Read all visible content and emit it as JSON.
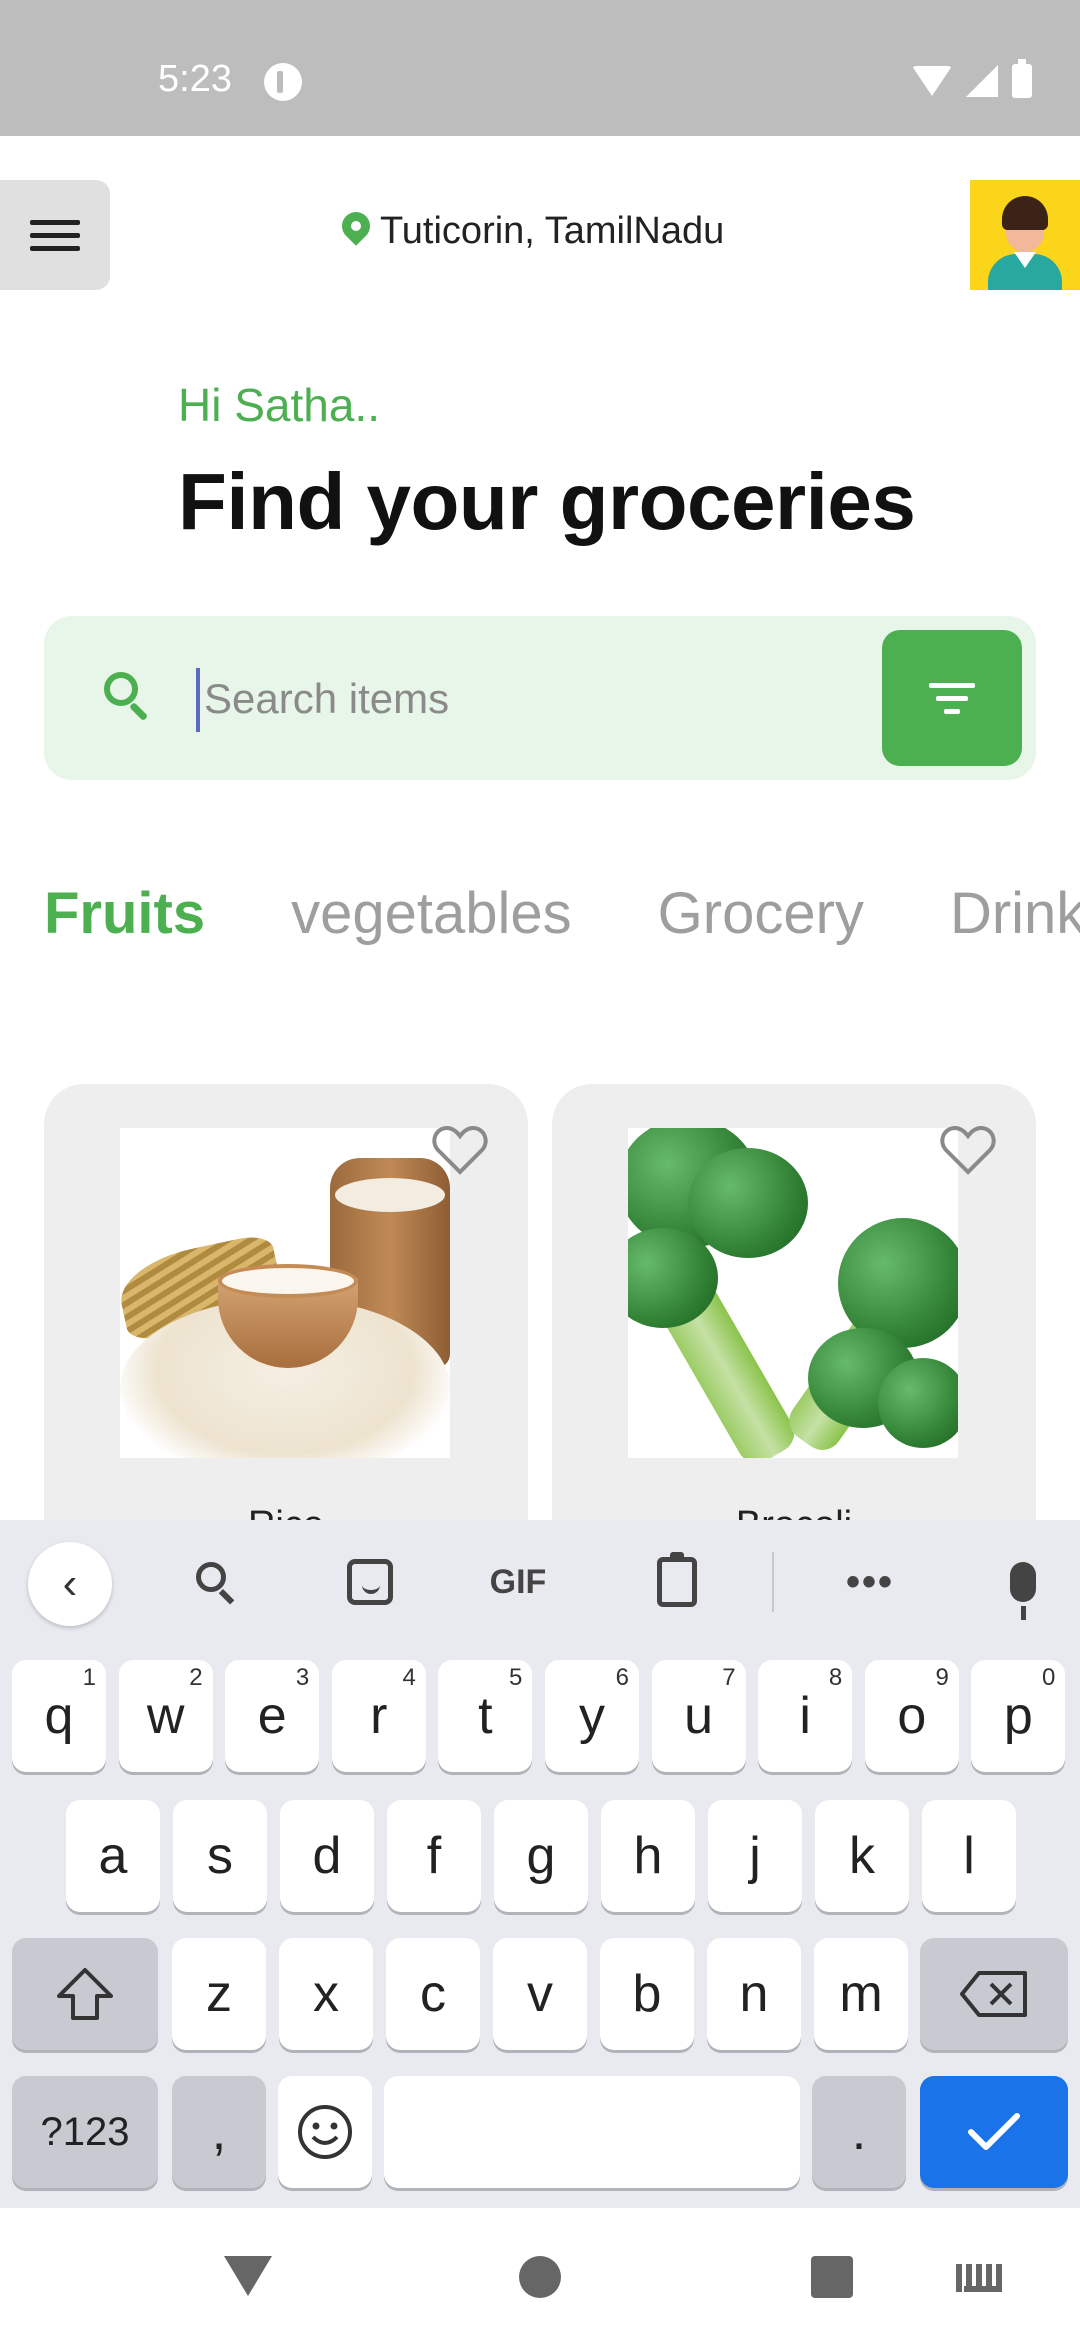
{
  "status_bar": {
    "time": "5:23"
  },
  "header": {
    "location": "Tuticorin, TamilNadu"
  },
  "greeting": "Hi Satha..",
  "headline": "Find your groceries",
  "search": {
    "placeholder": "Search items",
    "value": ""
  },
  "categories": [
    {
      "label": "Fruits",
      "active": true
    },
    {
      "label": "vegetables",
      "active": false
    },
    {
      "label": "Grocery",
      "active": false
    },
    {
      "label": "Drinks",
      "active": false
    }
  ],
  "products": [
    {
      "name": "Rice",
      "favorite": false
    },
    {
      "name": "Brocoli",
      "favorite": false
    }
  ],
  "keyboard": {
    "toolbar": {
      "gif_label": "GIF",
      "more_label": "•••"
    },
    "row1": [
      {
        "k": "q",
        "n": "1"
      },
      {
        "k": "w",
        "n": "2"
      },
      {
        "k": "e",
        "n": "3"
      },
      {
        "k": "r",
        "n": "4"
      },
      {
        "k": "t",
        "n": "5"
      },
      {
        "k": "y",
        "n": "6"
      },
      {
        "k": "u",
        "n": "7"
      },
      {
        "k": "i",
        "n": "8"
      },
      {
        "k": "o",
        "n": "9"
      },
      {
        "k": "p",
        "n": "0"
      }
    ],
    "row2": [
      "a",
      "s",
      "d",
      "f",
      "g",
      "h",
      "j",
      "k",
      "l"
    ],
    "row3": [
      "z",
      "x",
      "c",
      "v",
      "b",
      "n",
      "m"
    ],
    "row4": {
      "symbols": "?123",
      "comma": ",",
      "period": "."
    }
  },
  "colors": {
    "accent": "#4caf50",
    "search_bg": "#e8f5e9",
    "enter_key": "#1a73e8"
  }
}
